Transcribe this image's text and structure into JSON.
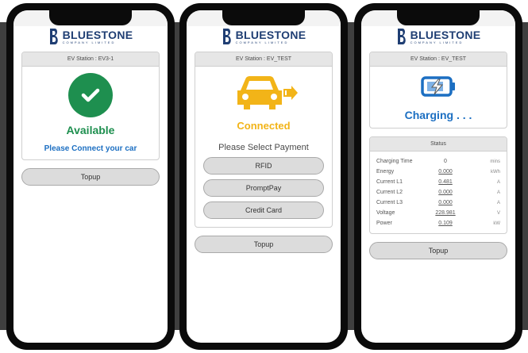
{
  "brand": {
    "name": "BLUESTONE",
    "tagline": "COMPANY LIMITED"
  },
  "screen1": {
    "station": "EV Station : EV3-1",
    "status": "Available",
    "hint": "Please Connect your car",
    "topup": "Topup",
    "icon": "check-icon"
  },
  "screen2": {
    "station": "EV Station : EV_TEST",
    "status": "Connected",
    "payment_title": "Please Select Payment",
    "payments": [
      "RFID",
      "PromptPay",
      "Credit Card"
    ],
    "topup": "Topup",
    "icon": "car-plug-icon"
  },
  "screen3": {
    "station": "EV Station : EV_TEST",
    "status": "Charging . . .",
    "status_panel_title": "Status",
    "rows": [
      {
        "label": "Charging Time",
        "value": "0",
        "unit": "mins"
      },
      {
        "label": "Energy",
        "value": "0.000",
        "unit": "kWh"
      },
      {
        "label": "Current L1",
        "value": "0.481",
        "unit": "A"
      },
      {
        "label": "Current L2",
        "value": "0.000",
        "unit": "A"
      },
      {
        "label": "Current L3",
        "value": "0.000",
        "unit": "A"
      },
      {
        "label": "Voltage",
        "value": "228.981",
        "unit": "V"
      },
      {
        "label": "Power",
        "value": "0.109",
        "unit": "kW"
      }
    ],
    "topup": "Topup",
    "icon": "battery-charging-icon"
  },
  "colors": {
    "brand_blue": "#1f3e73",
    "available_green": "#1e8f4f",
    "connected_yellow": "#f2b418",
    "charging_blue": "#1c6fc2"
  }
}
